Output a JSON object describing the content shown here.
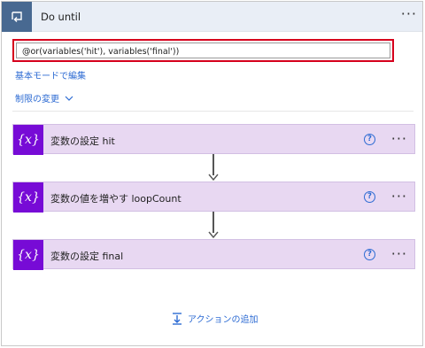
{
  "header": {
    "title": "Do until",
    "more_label": "···",
    "icon": "loop-icon"
  },
  "condition": {
    "expression": "@or(variables('hit'), variables('final'))"
  },
  "links": {
    "edit_basic": "基本モードで編集",
    "change_limits": "制限の変更"
  },
  "actions": [
    {
      "label": "変数の設定 hit",
      "icon_text": "{x}",
      "help": "?",
      "more": "···"
    },
    {
      "label": "変数の値を増やす loopCount",
      "icon_text": "{x}",
      "help": "?",
      "more": "···"
    },
    {
      "label": "変数の設定 final",
      "icon_text": "{x}",
      "help": "?",
      "more": "···"
    }
  ],
  "add_action": {
    "label": "アクションの追加",
    "icon": "add-action-icon"
  },
  "colors": {
    "header_bg": "#e9eef6",
    "header_icon_bg": "#486991",
    "action_bg": "#e8d8f2",
    "action_icon_bg": "#770bd6",
    "link": "#2d6bd3",
    "highlight_border": "#d6001c"
  }
}
